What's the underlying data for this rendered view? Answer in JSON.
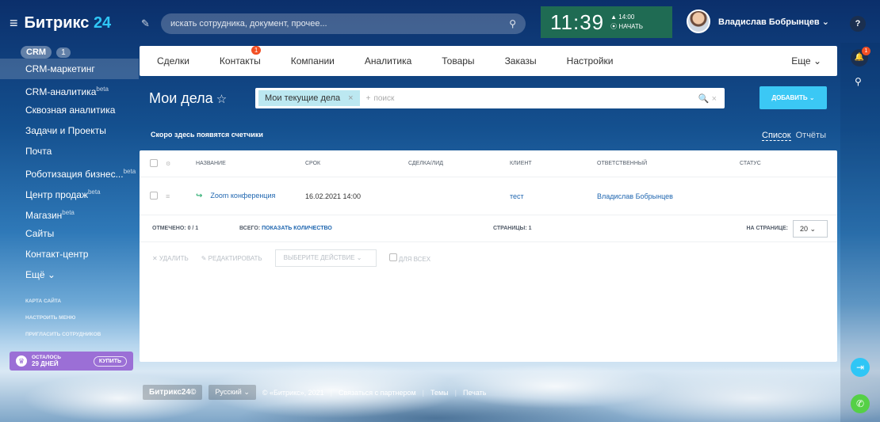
{
  "header": {
    "logo_text": "Битрикс",
    "logo_num": "24",
    "search_placeholder": "искать сотрудника, документ, прочее...",
    "clock": "11:39",
    "alarm": "▲ 14:00",
    "start_label": "⦿ НАЧАТЬ",
    "user_name": "Владислав Бобрынцев",
    "help_label": "?"
  },
  "sidebar": {
    "crm_label": "CRM",
    "crm_count": "1",
    "items": [
      {
        "label": "CRM-маркетинг",
        "sup": ""
      },
      {
        "label": "CRM-аналитика",
        "sup": "beta"
      },
      {
        "label": "Сквозная аналитика",
        "sup": ""
      },
      {
        "label": "Задачи и Проекты",
        "sup": ""
      },
      {
        "label": "Почта",
        "sup": ""
      },
      {
        "label": "Роботизация бизнес...",
        "sup": "beta"
      },
      {
        "label": "Центр продаж",
        "sup": "beta"
      },
      {
        "label": "Магазин",
        "sup": "beta"
      },
      {
        "label": "Сайты",
        "sup": ""
      },
      {
        "label": "Контакт-центр",
        "sup": ""
      },
      {
        "label": "Ещё ⌄",
        "sup": ""
      }
    ],
    "small_links": [
      "КАРТА САЙТА",
      "НАСТРОИТЬ МЕНЮ",
      "ПРИГЛАСИТЬ СОТРУДНИКОВ"
    ],
    "trial_top": "ОСТАЛОСЬ",
    "trial_days": "29 ДНЕЙ",
    "buy_label": "КУПИТЬ"
  },
  "tabs": {
    "items": [
      "Сделки",
      "Контакты",
      "Компании",
      "Аналитика",
      "Товары",
      "Заказы",
      "Настройки"
    ],
    "contacts_badge": "1",
    "more": "Еще ⌄"
  },
  "main": {
    "title": "Мои дела",
    "filter_chip": "Мои текущие дела",
    "filter_chip_x": "×",
    "filter_plus": "+",
    "filter_placeholder": "поиск",
    "filter_tools": "🔍 ×",
    "add_button": "ДОБАВИТЬ ⌄",
    "counters_text": "Скоро здесь появятся счетчики",
    "view_list": "Список",
    "view_reports": "Отчёты"
  },
  "grid": {
    "columns": [
      "НАЗВАНИЕ",
      "СРОК",
      "СДЕЛКА/ЛИД",
      "КЛИЕНТ",
      "ОТВЕТСТВЕННЫЙ",
      "СТАТУС"
    ],
    "rows": [
      {
        "name": "Zoom конференция",
        "deadline": "16.02.2021 14:00",
        "deal": "",
        "client": "тест",
        "responsible": "Владислав Бобрынцев",
        "status": ""
      }
    ],
    "marked_label": "ОТМЕЧЕНО: 0 / 1",
    "total_label": "ВСЕГО:",
    "total_link": "ПОКАЗАТЬ КОЛИЧЕСТВО",
    "pages_label": "СТРАНИЦЫ: 1",
    "per_page_label": "НА СТРАНИЦЕ:",
    "per_page_value": "20",
    "delete_label": "✕ УДАЛИТЬ",
    "edit_label": "✎ РЕДАКТИРОВАТЬ",
    "action_select": "ВЫБЕРИТЕ ДЕЙСТВИЕ",
    "for_all_label": "ДЛЯ ВСЕХ"
  },
  "footer": {
    "brand": "Битрикс24©",
    "lang": "Русский ⌄",
    "copyright": "© «Битрикс», 2021",
    "partner": "Связаться с партнером",
    "themes": "Темы",
    "print": "Печать"
  },
  "rail": {
    "bell_badge": "1"
  }
}
